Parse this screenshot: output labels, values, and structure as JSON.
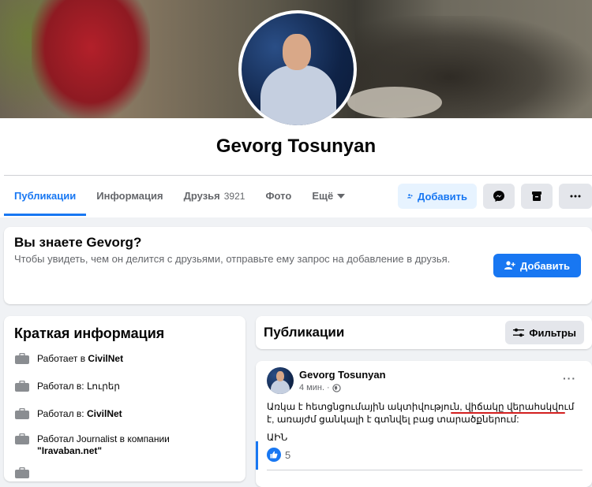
{
  "profile": {
    "name": "Gevorg Tosunyan"
  },
  "tabs": [
    {
      "label": "Публикации",
      "active": true
    },
    {
      "label": "Информация"
    },
    {
      "label": "Друзья",
      "count": "3921"
    },
    {
      "label": "Фото"
    },
    {
      "label": "Ещё"
    }
  ],
  "actions": {
    "add_label": "Добавить",
    "messenger_icon": "messenger-icon",
    "save_icon": "bookmark-icon",
    "more_icon": "more-icon"
  },
  "know": {
    "title": "Вы знаете Gevorg?",
    "text": "Чтобы увидеть, чем он делится с друзьями, отправьте ему запрос на добавление в друзья.",
    "button": "Добавить"
  },
  "intro": {
    "title": "Краткая информация",
    "items": [
      {
        "prefix": "Работает в ",
        "bold": "CivilNet",
        "suffix": ""
      },
      {
        "prefix": "Работал в: ",
        "bold": "",
        "suffix": "Լուրեր"
      },
      {
        "prefix": "Работал в: ",
        "bold": "CivilNet",
        "suffix": ""
      },
      {
        "prefix": "Работал Journalist в компании ",
        "bold": "\"Iravaban.net\"",
        "suffix": ""
      }
    ]
  },
  "posts": {
    "title": "Публикации",
    "filter_label": "Фильтры"
  },
  "post": {
    "author": "Gevorg Tosunyan",
    "time": "4 мин.",
    "more": "···",
    "text": "Առկա է հետցնցումային ակտիվություն, վիճակը վերահսկվում է, առայժմ ցանկալի է գտնվել բաց տարածքներում:",
    "signature": "ԱԻՆ",
    "likes": "5"
  },
  "colors": {
    "accent": "#1877f2",
    "underline": "#d32020"
  }
}
